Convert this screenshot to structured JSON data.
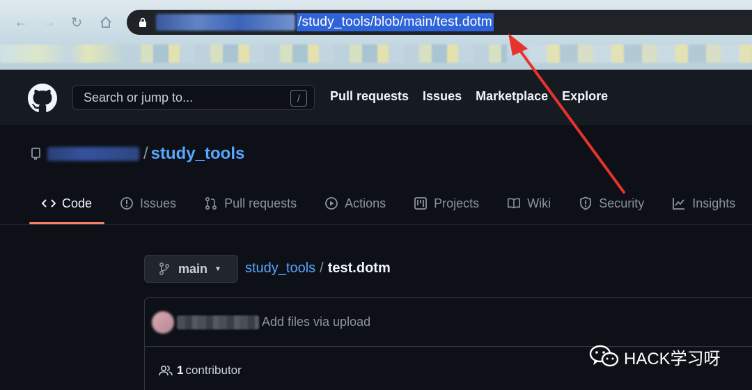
{
  "browser": {
    "url_path": "/study_tools/blob/main/test.dotm"
  },
  "github": {
    "search_placeholder": "Search or jump to...",
    "search_shortcut": "/",
    "nav": [
      "Pull requests",
      "Issues",
      "Marketplace",
      "Explore"
    ]
  },
  "repo": {
    "separator": "/",
    "name": "study_tools",
    "tabs": [
      {
        "label": "Code",
        "icon": "code-icon",
        "active": true
      },
      {
        "label": "Issues",
        "icon": "issue-opened-icon"
      },
      {
        "label": "Pull requests",
        "icon": "git-pull-request-icon"
      },
      {
        "label": "Actions",
        "icon": "play-icon"
      },
      {
        "label": "Projects",
        "icon": "project-icon"
      },
      {
        "label": "Wiki",
        "icon": "book-icon"
      },
      {
        "label": "Security",
        "icon": "shield-icon"
      },
      {
        "label": "Insights",
        "icon": "graph-icon"
      }
    ]
  },
  "file": {
    "branch": "main",
    "breadcrumb_repo": "study_tools",
    "breadcrumb_sep": "/",
    "breadcrumb_file": "test.dotm",
    "commit_message": "Add files via upload",
    "contributors_count": "1",
    "contributors_label": "contributor"
  },
  "watermark": {
    "text": "HACK学习呀"
  },
  "colors": {
    "accent_link": "#58a6ff",
    "tab_underline": "#f78166",
    "annotation_arrow": "#e8322d",
    "url_highlight": "#2f63d9"
  }
}
